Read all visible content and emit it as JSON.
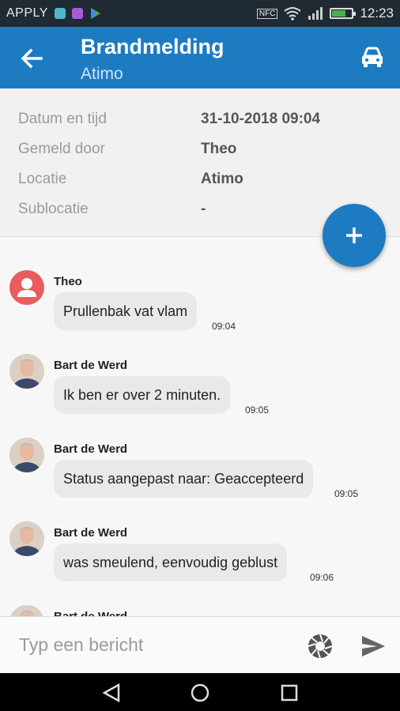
{
  "status_bar": {
    "carrier": "APPLY",
    "nfc": "NFC",
    "time": "12:23",
    "battery_level": 0.7,
    "app_icon_colors": [
      "#4fb6c7",
      "#a85bd6"
    ],
    "battery_color": "#4caf50"
  },
  "app_bar": {
    "title": "Brandmelding",
    "subtitle": "Atimo",
    "back_icon": "arrow-left-icon",
    "action_icon": "car-icon",
    "color": "#1d7bc2"
  },
  "details": [
    {
      "label": "Datum en tijd",
      "value": "31-10-2018 09:04"
    },
    {
      "label": "Gemeld door",
      "value": "Theo"
    },
    {
      "label": "Locatie",
      "value": "Atimo"
    },
    {
      "label": "Sublocatie",
      "value": "-"
    }
  ],
  "fab": {
    "icon": "plus-icon"
  },
  "messages": [
    {
      "sender": "Theo",
      "text": "Prullenbak vat vlam",
      "time": "09:04",
      "avatar": "default-user-avatar"
    },
    {
      "sender": "Bart de Werd",
      "text": "Ik ben er over 2 minuten.",
      "time": "09:05",
      "avatar": "photo-avatar"
    },
    {
      "sender": "Bart de Werd",
      "text": "Status aangepast naar: Geaccepteerd",
      "time": "09:05",
      "avatar": "photo-avatar"
    },
    {
      "sender": "Bart de Werd",
      "text": "was smeulend, eenvoudig geblust",
      "time": "09:06",
      "avatar": "photo-avatar"
    },
    {
      "sender": "Bart de Werd",
      "text": "",
      "time": "",
      "avatar": "photo-avatar"
    }
  ],
  "composer": {
    "placeholder": "Typ een bericht",
    "camera_icon": "camera-aperture-icon",
    "send_icon": "send-icon"
  },
  "nav_bar": {
    "icons": [
      "back-triangle-icon",
      "home-circle-icon",
      "recents-square-icon"
    ]
  }
}
